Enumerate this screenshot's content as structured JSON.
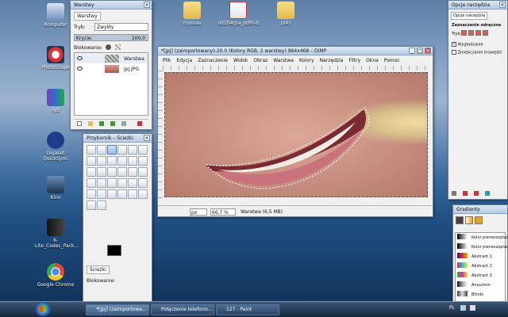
{
  "desktop": {
    "icons": [
      {
        "label": "Komputer"
      },
      {
        "label": "PhotoScape"
      },
      {
        "label": "xyz"
      },
      {
        "label": "Gigaset QuickSync"
      },
      {
        "label": "Kino"
      },
      {
        "label": "K-Lite_Codec_Pack..."
      },
      {
        "label": "Google Chrome"
      },
      {
        "label": "mysoav"
      },
      {
        "label": "0d1fi4rpa_pdf6-8"
      },
      {
        "label": "pliki"
      }
    ]
  },
  "layers_window": {
    "title": "Warstwy",
    "tab": "Warstwy",
    "mode_label": "Tryb:",
    "mode_value": "Zwykły",
    "opacity_label": "Krycie:",
    "opacity_value": "100,0",
    "lock_label": "Blokowanie:",
    "layers": [
      {
        "name": "Warstwa"
      },
      {
        "name": "jpj.JPG"
      }
    ]
  },
  "toolbox": {
    "title": "Przybornik – Ścieżki",
    "options_tab": "Ścieżki",
    "options_label": "Blokowanie:"
  },
  "image_window": {
    "title": "*[jpj] (zaimportowany)-20.0 (Kolory RGB, 2 warstwy) 964x468 – GIMP",
    "menu": [
      "Plik",
      "Edycja",
      "Zaznaczenie",
      "Widok",
      "Obraz",
      "Warstwa",
      "Kolory",
      "Narzędzia",
      "Filtry",
      "Okna",
      "Pomoc"
    ],
    "unit": "px",
    "zoom": "66,7 %",
    "status": "Warstwa (6,5 MB)"
  },
  "tool_options": {
    "title": "Opcje narzędzia",
    "tab": "Opcje narzędzia",
    "heading": "Zaznaczenie odręczne",
    "tryb_label": "Tryb:",
    "antialias": "Wygładzanie",
    "feather": "Zmiękczanie krawędzi",
    "antialias_checked": true,
    "feather_checked": false
  },
  "gradients": {
    "title": "Gradienty",
    "items": [
      {
        "name": "Kolor pierwszoplanowy",
        "colors": "#000000,#ffffff"
      },
      {
        "name": "Kolor pierwszoplanowy",
        "colors": "#000000,rgba(0,0,0,0)"
      },
      {
        "name": "Abstract 1",
        "colors": "#2a1d6b,#d0304a,#f1b400"
      },
      {
        "name": "Abstract 2",
        "colors": "#f02020,#20c0f0,#f0f020"
      },
      {
        "name": "Abstract 3",
        "colors": "#20c020,#f020c0,#f0f020"
      },
      {
        "name": "Aneurism",
        "colors": "#101010,#a0a0a0,#ffffff"
      },
      {
        "name": "Blinds",
        "colors": "#404040,#e0e0e0,#404040"
      }
    ]
  },
  "taskbar": {
    "tasks": [
      {
        "label": "*[jpj] (zaimportowa..."
      },
      {
        "label": "Połączenie telefonic..."
      },
      {
        "label": "127 - Paint"
      }
    ],
    "lang": "PL"
  }
}
